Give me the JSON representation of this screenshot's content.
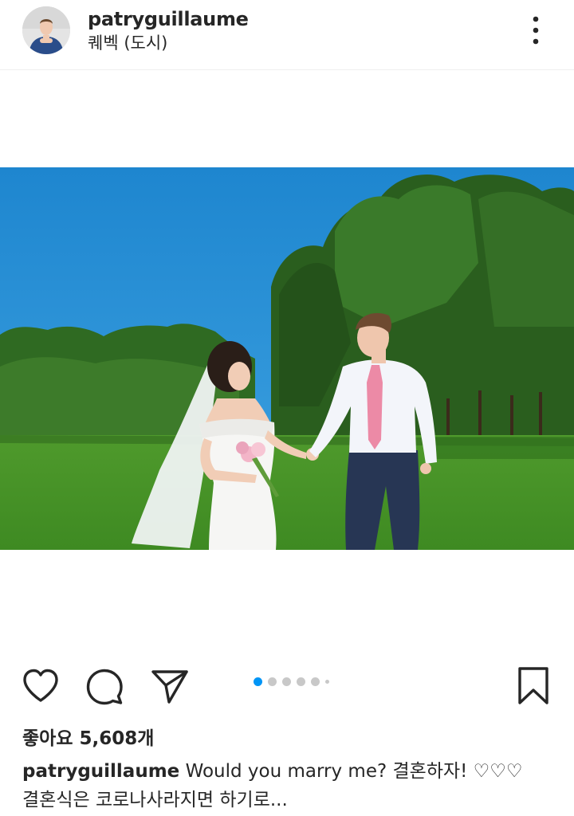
{
  "post": {
    "username": "patryguillaume",
    "location": "퀘벡 (도시)",
    "likes_text": "좋아요 5,608개",
    "caption_user": "patryguillaume",
    "caption_line1": "Would you marry me? 결혼하자! ♡♡♡",
    "caption_line2": "결혼식은 코로나사라지면 하기로..."
  },
  "carousel": {
    "total_dots": 6,
    "active_index": 0
  },
  "icons": {
    "more": "more-vertical-icon",
    "like": "heart-icon",
    "comment": "comment-bubble-icon",
    "share": "paper-plane-icon",
    "save": "bookmark-icon"
  },
  "colors": {
    "text": "#262626",
    "accent": "#0095f6",
    "dot_inactive": "#c8c8c8",
    "divider": "#efefef"
  }
}
